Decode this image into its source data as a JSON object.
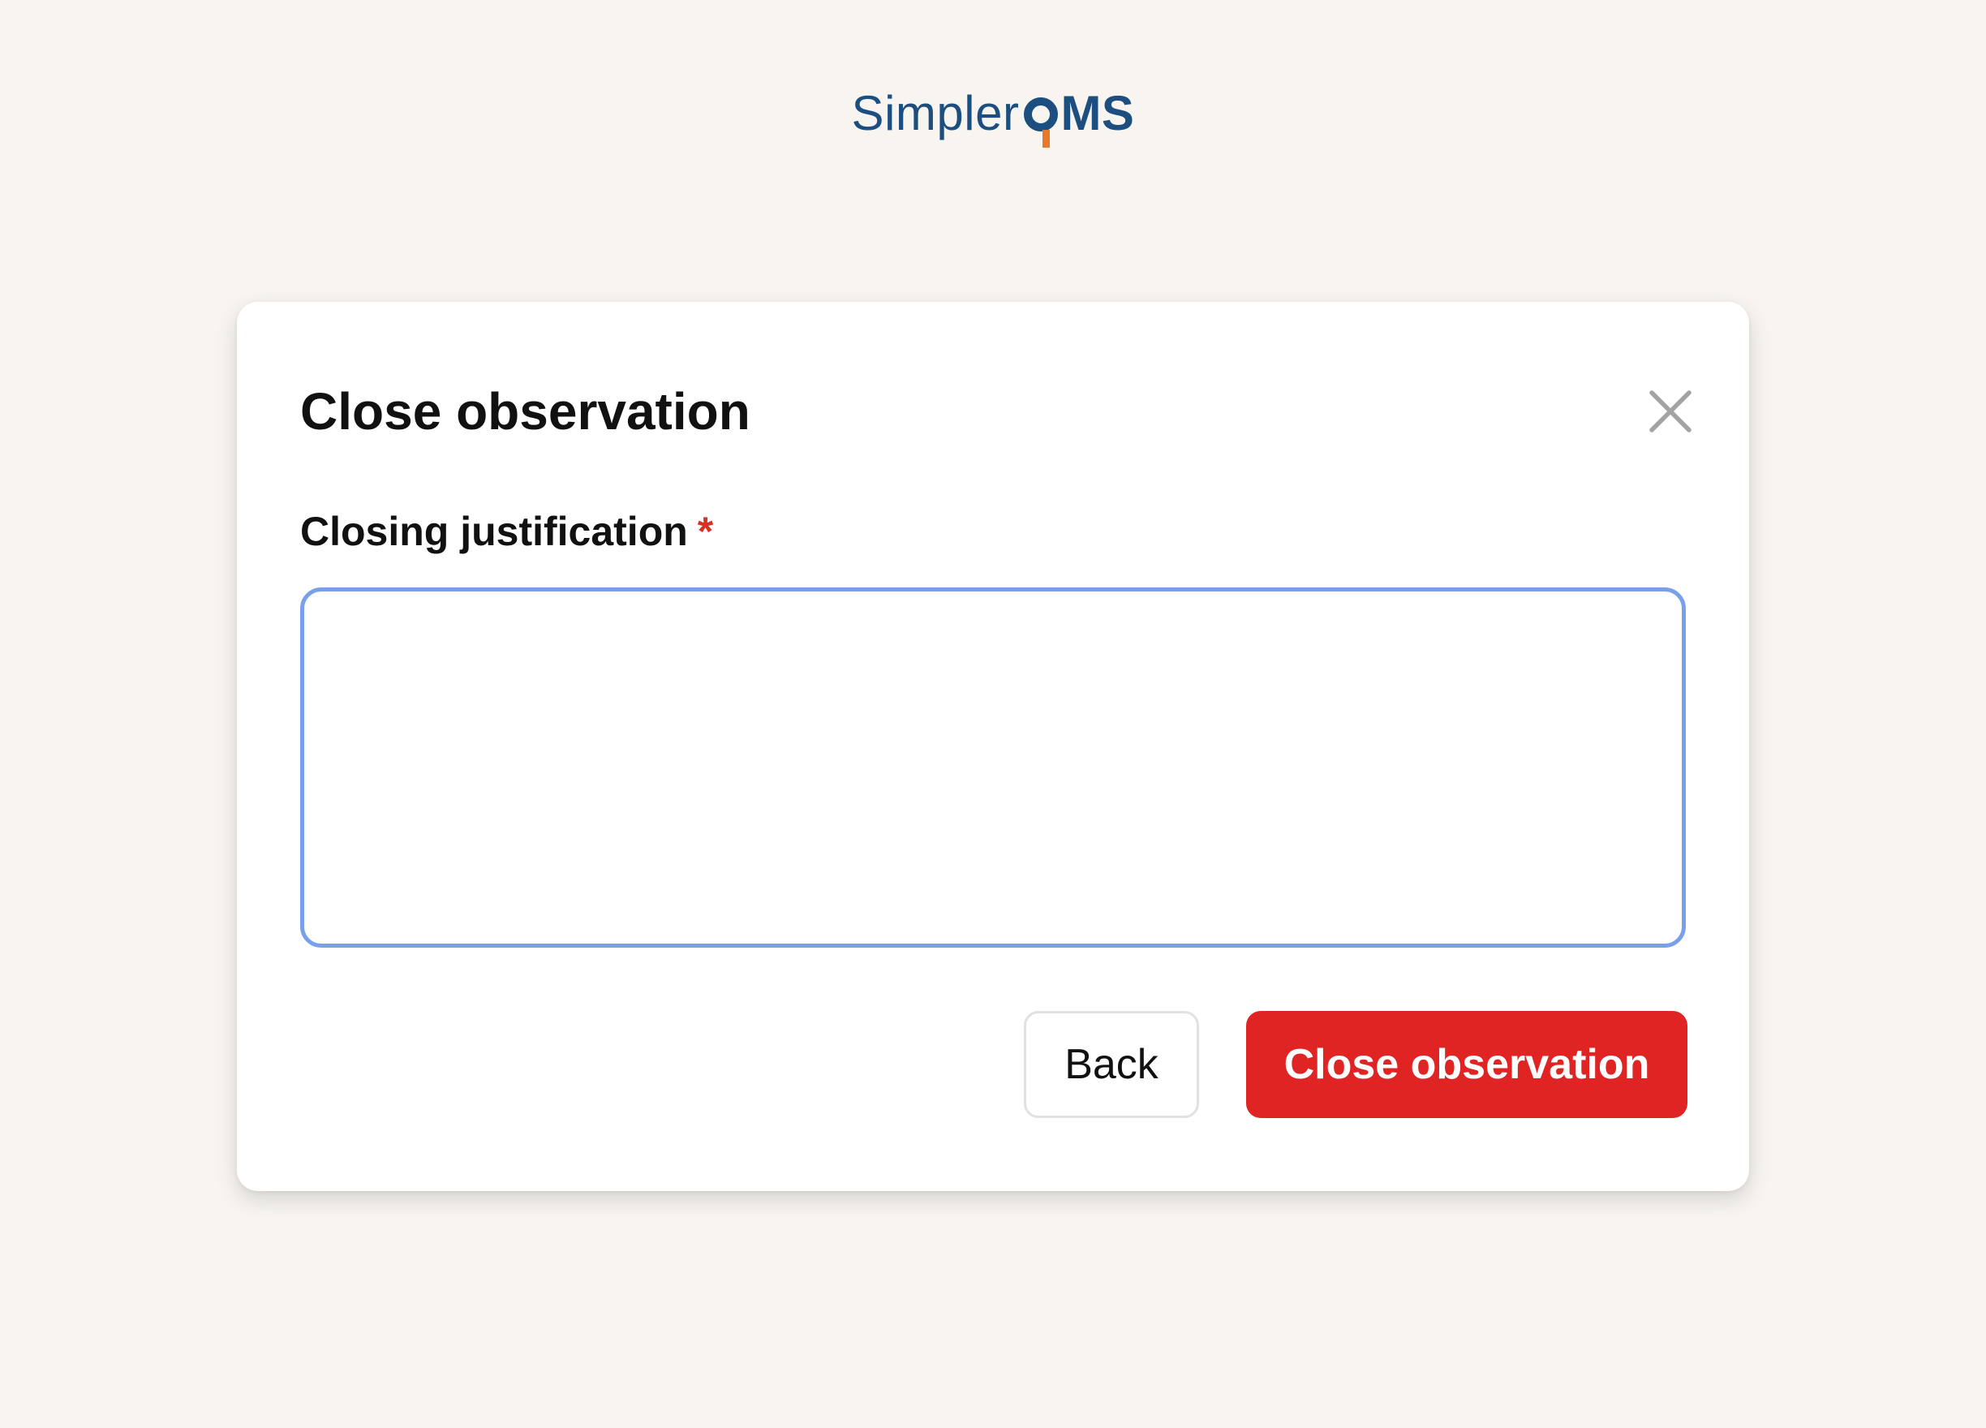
{
  "colors": {
    "page_background": "#f8f5f1",
    "logo_blue": "#1d4e80",
    "logo_orange": "#e8792b",
    "focus_border": "#7aa0ea",
    "danger": "#e02424",
    "required": "#d93025",
    "close_icon": "#a3a3a3"
  },
  "logo": {
    "light_part": "Simpler",
    "strong_part": "MS"
  },
  "modal": {
    "title": "Close observation",
    "close_icon": "close-icon",
    "field": {
      "label": "Closing justification",
      "required_mark": "*",
      "value": ""
    },
    "buttons": {
      "back": "Back",
      "confirm": "Close observation"
    }
  }
}
